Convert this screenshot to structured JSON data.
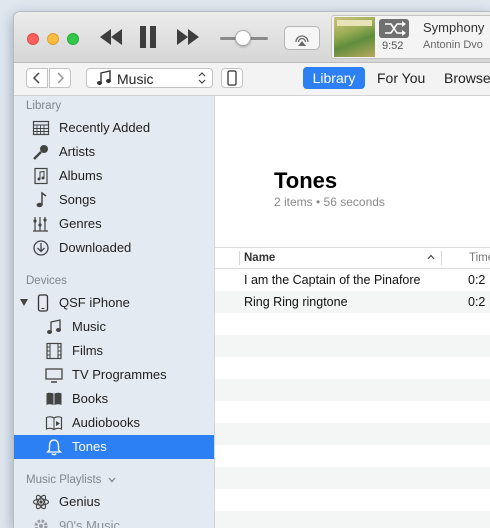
{
  "now_playing": {
    "time": "9:52",
    "title": "Symphony",
    "artist": "Antonin Dvo"
  },
  "nav": {
    "media_kind": "Music",
    "tabs": [
      {
        "label": "Library",
        "active": true
      },
      {
        "label": "For You",
        "active": false
      },
      {
        "label": "Browse",
        "active": false
      }
    ]
  },
  "sidebar": {
    "library_header": "Library",
    "library_items": [
      {
        "label": "Recently Added",
        "icon": "recently-added-icon"
      },
      {
        "label": "Artists",
        "icon": "microphone-icon"
      },
      {
        "label": "Albums",
        "icon": "album-icon"
      },
      {
        "label": "Songs",
        "icon": "music-note-icon"
      },
      {
        "label": "Genres",
        "icon": "genres-icon"
      },
      {
        "label": "Downloaded",
        "icon": "download-icon"
      }
    ],
    "devices_header": "Devices",
    "device_name": "QSF iPhone",
    "device_items": [
      {
        "label": "Music",
        "icon": "music-note-icon"
      },
      {
        "label": "Films",
        "icon": "film-icon"
      },
      {
        "label": "TV Programmes",
        "icon": "tv-icon"
      },
      {
        "label": "Books",
        "icon": "book-icon"
      },
      {
        "label": "Audiobooks",
        "icon": "audiobook-icon"
      },
      {
        "label": "Tones",
        "icon": "bell-icon",
        "selected": true
      }
    ],
    "playlists_header": "Music Playlists",
    "playlist_items": [
      {
        "label": "Genius",
        "icon": "genius-icon"
      },
      {
        "label": "90's Music",
        "icon": "gear-icon"
      }
    ]
  },
  "content": {
    "title": "Tones",
    "subtitle": "2 items • 56 seconds",
    "columns": {
      "name": "Name",
      "time": "Time"
    },
    "rows": [
      {
        "name": "I am the Captain of the Pinafore",
        "time": "0:2"
      },
      {
        "name": "Ring Ring ringtone",
        "time": "0:2"
      }
    ]
  },
  "colors": {
    "accent": "#2d80f3",
    "sidebar": "#e3eaf1"
  }
}
